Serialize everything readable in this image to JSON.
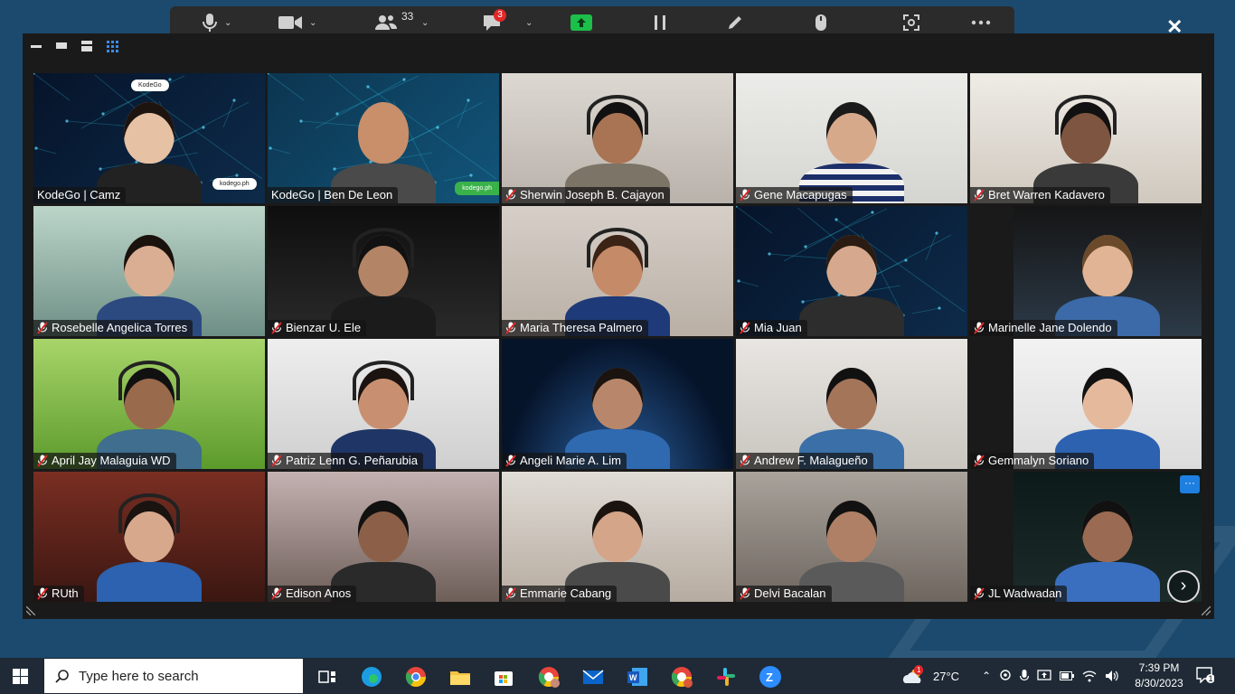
{
  "toolbar": {
    "participants_count": "33",
    "chat_badge": "3"
  },
  "participants": [
    {
      "name": "KodeGo | Camz",
      "muted": false,
      "active": true
    },
    {
      "name": "KodeGo | Ben De Leon",
      "muted": false,
      "active": false
    },
    {
      "name": "Sherwin Joseph B. Cajayon",
      "muted": true,
      "active": false
    },
    {
      "name": "Gene Macapugas",
      "muted": true,
      "active": false
    },
    {
      "name": "Bret Warren Kadavero",
      "muted": true,
      "active": false
    },
    {
      "name": "Rosebelle Angelica Torres",
      "muted": true,
      "active": false
    },
    {
      "name": "Bienzar U. Ele",
      "muted": true,
      "active": false
    },
    {
      "name": "Maria Theresa Palmero",
      "muted": true,
      "active": false
    },
    {
      "name": "Mia Juan",
      "muted": true,
      "active": false
    },
    {
      "name": "Marinelle Jane Dolendo",
      "muted": true,
      "active": false
    },
    {
      "name": "April Jay Malaguia WD",
      "muted": true,
      "active": false
    },
    {
      "name": "Patriz Lenn G. Peñarubia",
      "muted": true,
      "active": false
    },
    {
      "name": "Angeli Marie A. Lim",
      "muted": true,
      "active": false
    },
    {
      "name": "Andrew F. Malagueño",
      "muted": true,
      "active": false
    },
    {
      "name": "Gemmalyn Soriano",
      "muted": true,
      "active": false
    },
    {
      "name": "RUth",
      "muted": true,
      "active": false
    },
    {
      "name": "Edison Anos",
      "muted": true,
      "active": false
    },
    {
      "name": "Emmarie Cabang",
      "muted": true,
      "active": false
    },
    {
      "name": "Delvi Bacalan",
      "muted": true,
      "active": false
    },
    {
      "name": "JL Wadwadan",
      "muted": true,
      "active": false
    }
  ],
  "branding": {
    "logo_top": "KodeGo",
    "logo_site": "kodego.ph"
  },
  "taskbar": {
    "search_placeholder": "Type here to search",
    "temperature": "27°C",
    "weather_badge": "1",
    "time": "7:39 PM",
    "date": "8/30/2023",
    "notification_count": "1"
  },
  "colors": {
    "active_speaker": "#e8e04a",
    "mute_red": "#e02828",
    "share_green": "#1bbf4a",
    "accent_blue": "#1f7fe0"
  }
}
